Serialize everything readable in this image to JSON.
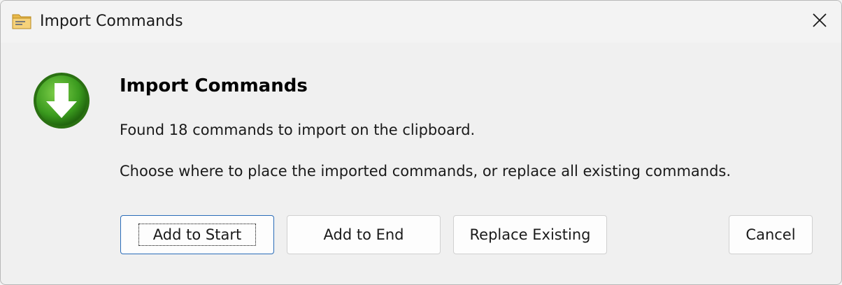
{
  "window": {
    "title": "Import Commands"
  },
  "dialog": {
    "heading": "Import Commands",
    "message_line1": "Found 18 commands to import on the clipboard.",
    "message_line2": "Choose where to place the imported commands, or replace all existing commands.",
    "icon": "download-arrow-icon"
  },
  "buttons": {
    "add_to_start": "Add to Start",
    "add_to_end": "Add to End",
    "replace_existing": "Replace Existing",
    "cancel": "Cancel"
  },
  "colors": {
    "accent_border": "#2a6cb8",
    "icon_green": "#3a9a1e"
  }
}
